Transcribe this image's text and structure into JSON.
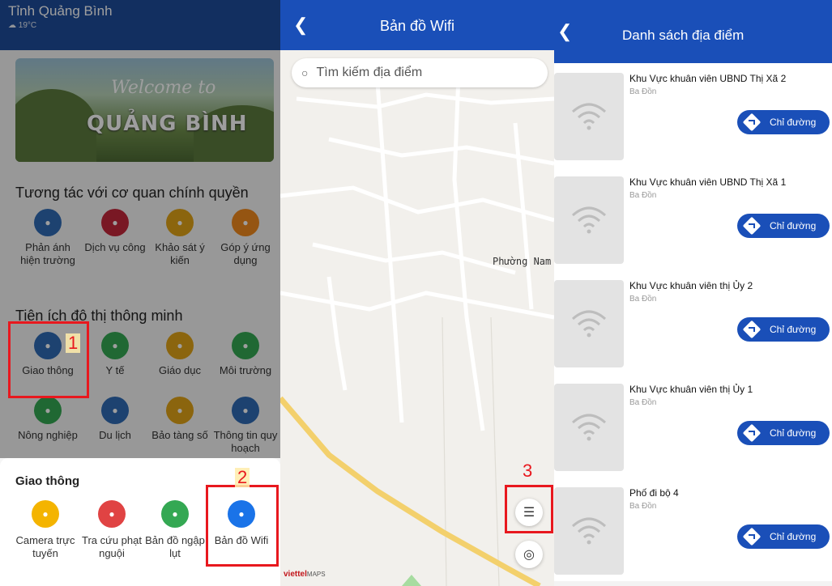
{
  "panel1": {
    "province": "Tỉnh Quảng Bình",
    "weather": "☁ 19°C",
    "banner": {
      "welcome": "Welcome to",
      "place": "QUẢNG BÌNH"
    },
    "section1": "Tương tác với cơ quan chính quyền",
    "interact_items": [
      {
        "label": "Phản ánh hiện trường",
        "color": "#2f6bb5",
        "icon": "megaphone-icon"
      },
      {
        "label": "Dịch vụ công",
        "color": "#c4273a",
        "icon": "service-icon"
      },
      {
        "label": "Khảo sát ý kiến",
        "color": "#e1a418",
        "icon": "survey-icon"
      },
      {
        "label": "Góp ý ứng dụng",
        "color": "#f08a1e",
        "icon": "feedback-icon"
      }
    ],
    "section2": "Tiện ích đô thị thông minh",
    "utility_items": [
      {
        "label": "Giao thông",
        "color": "#2f6bb5",
        "icon": "traffic-icon"
      },
      {
        "label": "Y tế",
        "color": "#34a853",
        "icon": "health-icon"
      },
      {
        "label": "Giáo dục",
        "color": "#e1a418",
        "icon": "education-icon"
      },
      {
        "label": "Môi trường",
        "color": "#34a853",
        "icon": "environment-icon"
      },
      {
        "label": "Nông nghiệp",
        "color": "#34a853",
        "icon": "agriculture-icon"
      },
      {
        "label": "Du lịch",
        "color": "#2f6bb5",
        "icon": "travel-icon"
      },
      {
        "label": "Bảo tàng số",
        "color": "#e1a418",
        "icon": "museum-icon"
      },
      {
        "label": "Thông tin quy hoạch",
        "color": "#2f6bb5",
        "icon": "planning-icon"
      }
    ],
    "sheet_title": "Giao thông",
    "sheet_items": [
      {
        "label": "Camera trực tuyến",
        "color": "#f4b400",
        "icon": "camera-icon"
      },
      {
        "label": "Tra cứu phạt nguội",
        "color": "#e04343",
        "icon": "car-icon"
      },
      {
        "label": "Bản đồ ngập lụt",
        "color": "#34a853",
        "icon": "flood-icon"
      },
      {
        "label": "Bản đồ Wifi",
        "color": "#1a73e8",
        "icon": "wifi-icon"
      }
    ],
    "step1": "1",
    "step2": "2"
  },
  "panel2": {
    "title": "Bản đồ Wifi",
    "search_placeholder": "Tìm kiếm địa điểm",
    "map_label": "Phường Nam",
    "step3": "3",
    "brand": "viettel",
    "brand_suffix": "MAPS"
  },
  "panel3": {
    "title": "Danh sách địa điểm",
    "direction_label": "Chỉ đường",
    "items": [
      {
        "name": "Khu Vực khuân viên UBND Thị Xã 2",
        "addr": "Ba Đồn"
      },
      {
        "name": "Khu Vực khuân viên UBND Thị Xã 1",
        "addr": "Ba Đồn"
      },
      {
        "name": "Khu Vực khuân viên thị Ủy 2",
        "addr": "Ba Đồn"
      },
      {
        "name": "Khu Vực khuân viên thị Ủy 1",
        "addr": "Ba Đồn"
      },
      {
        "name": "Phố đi bộ 4",
        "addr": "Ba Đồn"
      }
    ]
  }
}
